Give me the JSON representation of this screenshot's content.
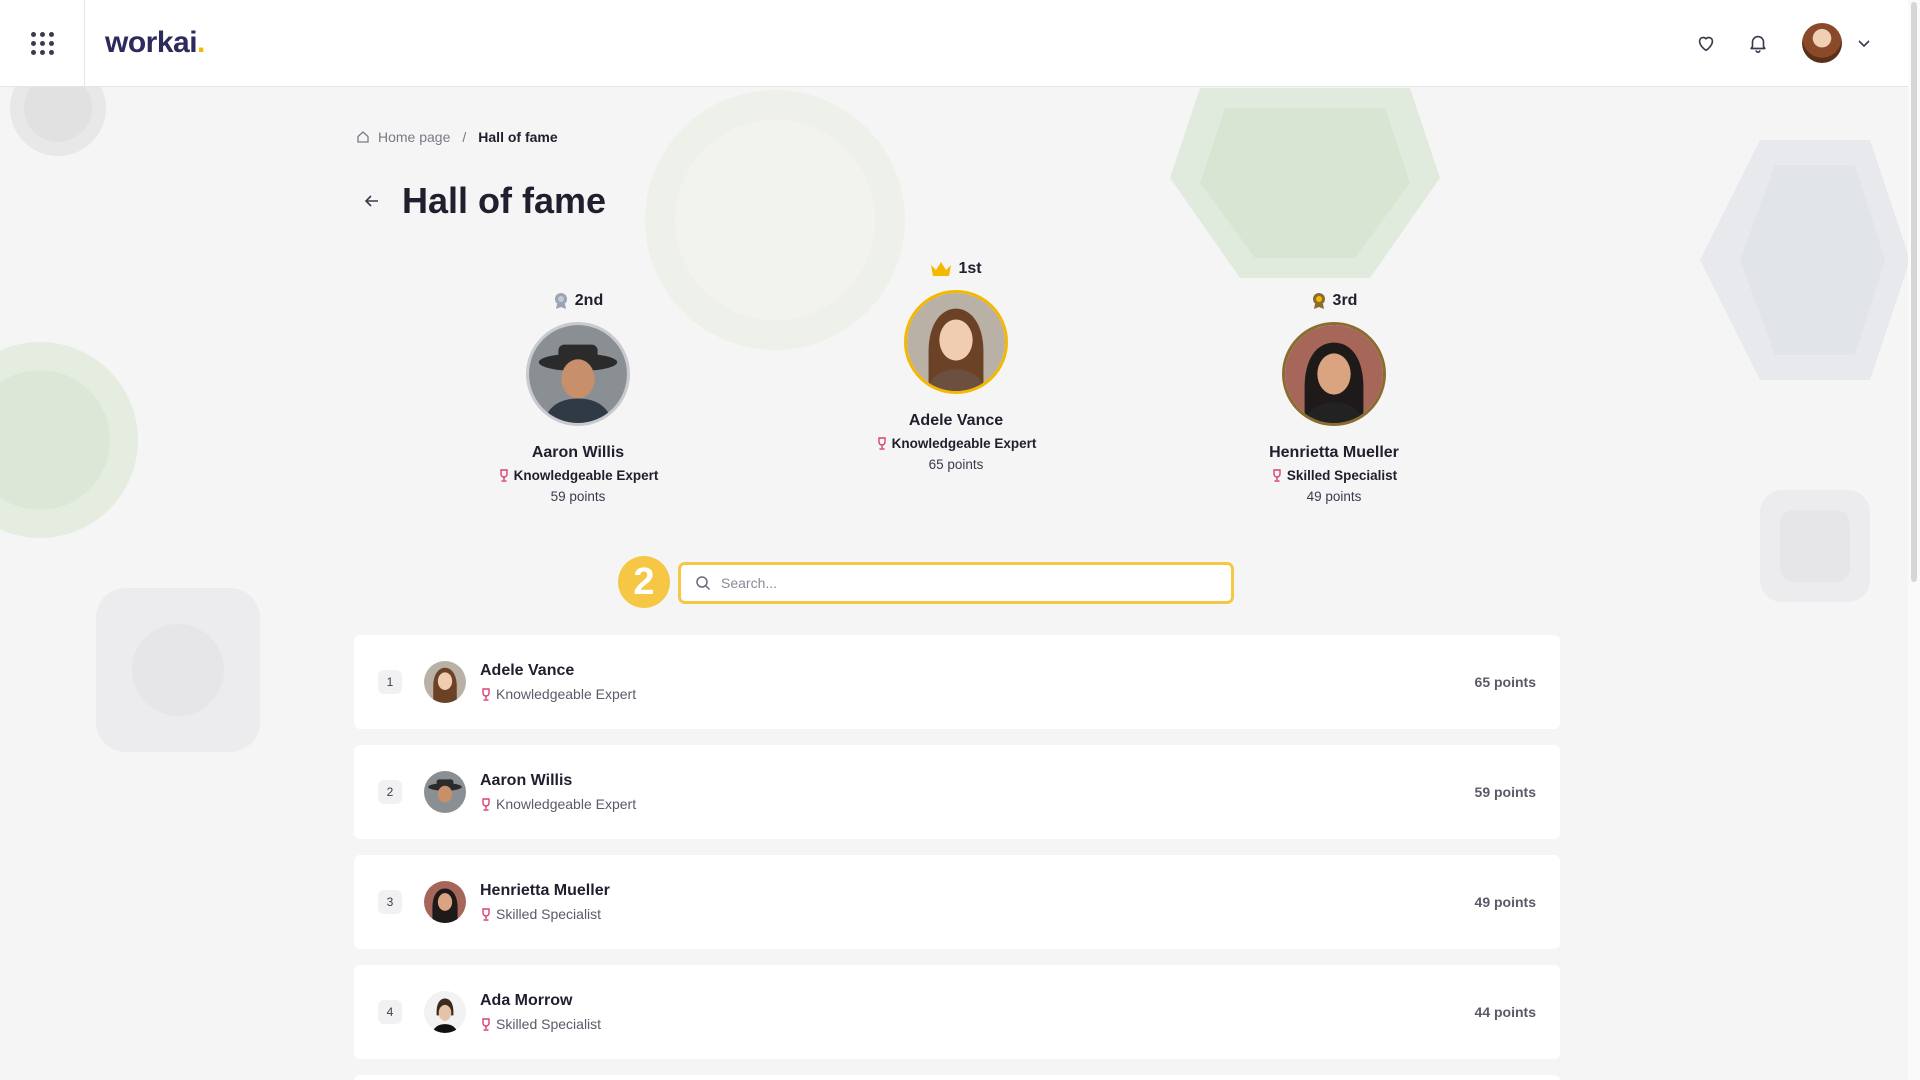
{
  "header": {
    "logo_text": "workai",
    "logo_dot": ".",
    "icons": [
      "apps-grid-icon",
      "heart-icon",
      "bell-icon",
      "chevron-down-icon"
    ]
  },
  "breadcrumb": {
    "home_label": "Home page",
    "separator": "/",
    "current": "Hall of fame"
  },
  "page": {
    "title": "Hall of fame"
  },
  "podium": {
    "first": {
      "place": "1st",
      "name": "Adele Vance",
      "badge": "Knowledgeable Expert",
      "points": "65 points"
    },
    "second": {
      "place": "2nd",
      "name": "Aaron Willis",
      "badge": "Knowledgeable Expert",
      "points": "59 points"
    },
    "third": {
      "place": "3rd",
      "name": "Henrietta Mueller",
      "badge": "Skilled Specialist",
      "points": "49 points"
    }
  },
  "step_marker": "2",
  "search": {
    "placeholder": "Search...",
    "value": ""
  },
  "ranking": [
    {
      "rank": "1",
      "name": "Adele Vance",
      "badge": "Knowledgeable Expert",
      "points": "65 points"
    },
    {
      "rank": "2",
      "name": "Aaron Willis",
      "badge": "Knowledgeable Expert",
      "points": "59 points"
    },
    {
      "rank": "3",
      "name": "Henrietta Mueller",
      "badge": "Skilled Specialist",
      "points": "49 points"
    },
    {
      "rank": "4",
      "name": "Ada Morrow",
      "badge": "Skilled Specialist",
      "points": "44 points"
    }
  ],
  "colors": {
    "accent_yellow": "#f6c744",
    "gold": "#f5b800",
    "badge_pink": "#d9426f",
    "logo_navy": "#2d2a5c"
  }
}
